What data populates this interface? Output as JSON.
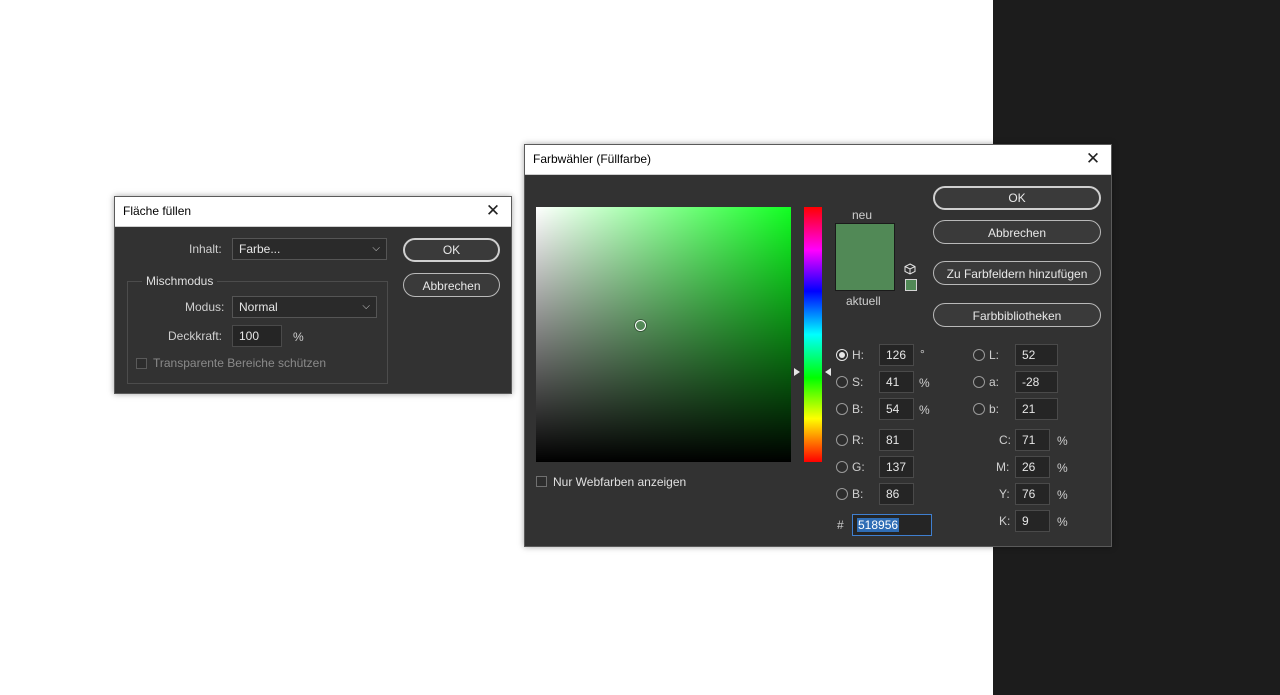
{
  "fill_dialog": {
    "title": "Fläche füllen",
    "content_label": "Inhalt:",
    "content_value": "Farbe...",
    "blend_group_label": "Mischmodus",
    "mode_label": "Modus:",
    "mode_value": "Normal",
    "opacity_label": "Deckkraft:",
    "opacity_value": "100",
    "opacity_unit": "%",
    "preserve_transparency_label": "Transparente Bereiche schützen",
    "ok_label": "OK",
    "cancel_label": "Abbrechen"
  },
  "picker": {
    "title": "Farbwähler (Füllfarbe)",
    "new_label": "neu",
    "current_label": "aktuell",
    "current_color": "#518956",
    "ok_label": "OK",
    "cancel_label": "Abbrechen",
    "add_swatches_label": "Zu Farbfeldern hinzufügen",
    "libraries_label": "Farbbibliotheken",
    "web_colors_label": "Nur Webfarben anzeigen",
    "hsb": {
      "h_label": "H:",
      "h_value": "126",
      "h_unit": "°",
      "s_label": "S:",
      "s_value": "41",
      "s_unit": "%",
      "b_label": "B:",
      "b_value": "54",
      "b_unit": "%"
    },
    "rgb": {
      "r_label": "R:",
      "r_value": "81",
      "g_label": "G:",
      "g_value": "137",
      "b_label": "B:",
      "b_value": "86"
    },
    "lab": {
      "l_label": "L:",
      "l_value": "52",
      "a_label": "a:",
      "a_value": "-28",
      "b_label": "b:",
      "b_value": "21"
    },
    "cmyk": {
      "c_label": "C:",
      "c_value": "71",
      "m_label": "M:",
      "m_value": "26",
      "y_label": "Y:",
      "y_value": "76",
      "k_label": "K:",
      "k_value": "9",
      "unit": "%"
    },
    "hex_label": "#",
    "hex_value": "518956"
  },
  "colors": {
    "dialog_bg": "#323232",
    "selected_color": "#518956",
    "hex_selection": "#2f6db5"
  },
  "icons": {
    "close": "close-icon",
    "gamut_warning": "cube-icon",
    "dropdown": "chevron-down-icon"
  }
}
